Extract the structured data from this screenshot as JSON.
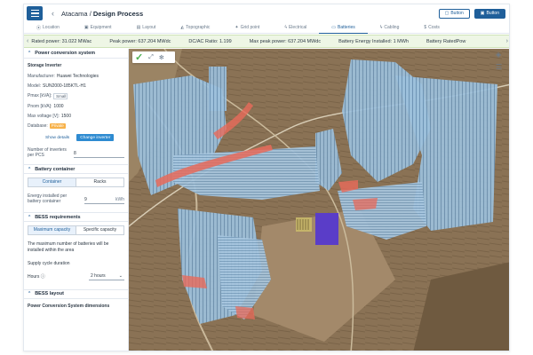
{
  "header": {
    "breadcrumb_project": "Atacama",
    "breadcrumb_sep": " / ",
    "breadcrumb_page": "Design Process",
    "button_outline": "Button",
    "button_solid": "Button"
  },
  "tabs": [
    {
      "label": "Location",
      "icon": "pin-icon",
      "glyph": "⦿"
    },
    {
      "label": "Equipment",
      "icon": "cart-icon",
      "glyph": "▣"
    },
    {
      "label": "Layout",
      "icon": "layout-icon",
      "glyph": "▤"
    },
    {
      "label": "Topographic",
      "icon": "topo-icon",
      "glyph": "◭"
    },
    {
      "label": "Grid point",
      "icon": "grid-point-icon",
      "glyph": "✦"
    },
    {
      "label": "Electrical",
      "icon": "electrical-icon",
      "glyph": "ϟ"
    },
    {
      "label": "Batteries",
      "icon": "battery-icon",
      "glyph": "▭"
    },
    {
      "label": "Cabling",
      "icon": "cabling-icon",
      "glyph": "ϟ"
    },
    {
      "label": "Costs",
      "icon": "costs-icon",
      "glyph": "$"
    }
  ],
  "active_tab": "Batteries",
  "metrics": [
    "Rated power: 31.022 MWac",
    "Peak power: 637.204 MWdc",
    "DC/AC Ratio: 1.199",
    "Max peak power: 637.204 MWdc",
    "Battery Energy Installed: 1 MWh",
    "Battery RatedPow"
  ],
  "panel": {
    "pcs": {
      "title": "Power conversion system",
      "subtitle": "Storage Inverter",
      "manufacturer_label": "Manufacturer:",
      "manufacturer": "Huawei Technologies",
      "model_label": "Model:",
      "model": "SUN2000-185KTL-H1",
      "pmax_label": "Pmax [kVA]:",
      "pmax": "Small",
      "pnom_label": "Pnom [kVA]:",
      "pnom": "1000",
      "maxv_label": "Max voltage [V]:",
      "maxv": "1500",
      "database_label": "Database:",
      "database": "Private",
      "show_details": "Show details",
      "change_inverter": "Change inverter",
      "num_inverters_label": "Number of inverters per PCS",
      "num_inverters": "8"
    },
    "battery": {
      "title": "Battery container",
      "tab_container": "Container",
      "tab_racks": "Racks",
      "energy_label": "Energy installed per battery container",
      "energy_value": "9",
      "energy_unit": "kWh"
    },
    "bess": {
      "title": "BESS requirements",
      "tab_max": "Maximum capacity",
      "tab_specific": "Specific capacity",
      "description": "The maximum number of batteries will be installed within the area",
      "supply_label": "Supply cycle duration",
      "hours_label": "Hours ⓘ",
      "hours_value": "2 hours"
    },
    "layout": {
      "title": "BESS layout",
      "dims_label": "Power Conversion System dimensions"
    }
  },
  "colors": {
    "brand": "#1f5f9a",
    "metrics_bg": "#eef6e5",
    "panel_blue": "#8fb7d6",
    "setback_red": "#e86a5a",
    "battery_purple": "#5a3dc8"
  }
}
